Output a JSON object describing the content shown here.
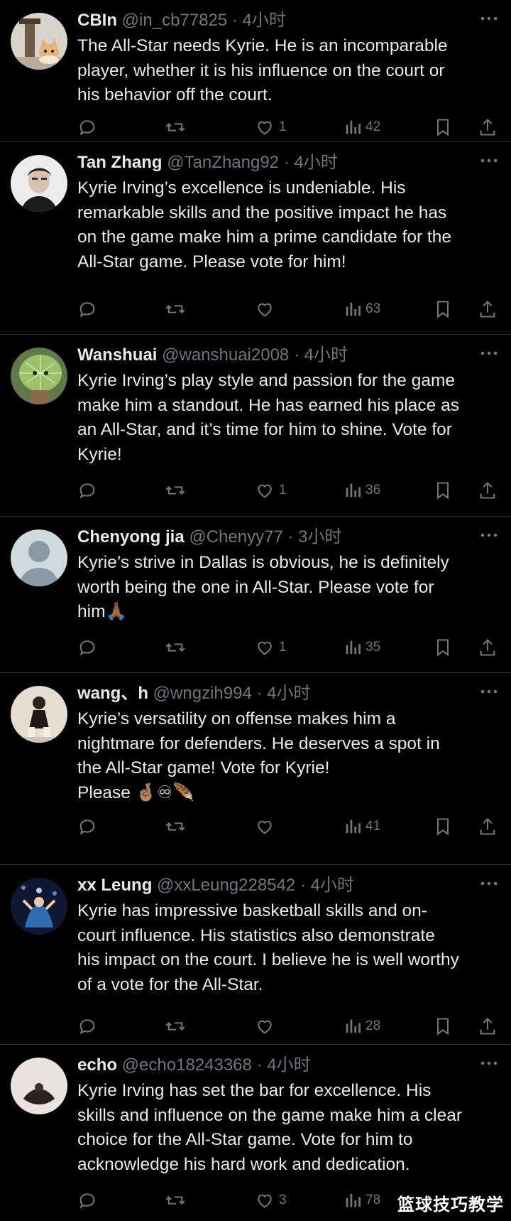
{
  "tweets": [
    {
      "name": "CBIn",
      "handle": "@in_cb77825",
      "time": "4小时",
      "lines": [
        "The All-Star needs Kyrie. He is an incomparable",
        "player, whether it is his influence on the court or",
        "his behavior off the court."
      ],
      "likes": "1",
      "views": "42"
    },
    {
      "name": "Tan Zhang",
      "handle": "@TanZhang92",
      "time": "4小时",
      "lines": [
        "Kyrie Irving’s excellence is undeniable. His",
        "remarkable skills and the positive impact he has",
        "on the game make him a prime candidate for the",
        "All-Star game. Please vote for him!"
      ],
      "likes": "",
      "views": "63"
    },
    {
      "name": "Wanshuai",
      "handle": "@wanshuai2008",
      "time": "4小时",
      "lines": [
        "Kyrie Irving’s play style and passion for the game",
        "make him a standout. He has earned his place as",
        "an All-Star, and it’s time for him to shine. Vote for",
        "Kyrie!"
      ],
      "likes": "1",
      "views": "36"
    },
    {
      "name": "Chenyong jia",
      "handle": "@Chenyy77",
      "time": "3小时",
      "lines": [
        "Kyrie’s strive in Dallas is obvious, he is definitely",
        "worth being the one in All-Star. Please vote for",
        "him🙏🏾"
      ],
      "likes": "1",
      "views": "35"
    },
    {
      "name": "wang、h",
      "handle": "@wngzih994",
      "time": "4小时",
      "lines": [
        "Kyrie’s versatility on offense makes him a",
        "nightmare for defenders. He deserves a spot in",
        "the All-Star game! Vote for Kyrie!",
        "Please 🤞🏽♾🪶"
      ],
      "likes": "",
      "views": "41"
    },
    {
      "name": "xx Leung",
      "handle": "@xxLeung228542",
      "time": "4小时",
      "lines": [
        "Kyrie has impressive basketball skills and on-",
        "court influence. His statistics also demonstrate",
        "his impact on the court. I believe he is well worthy",
        "of a vote for the All-Star."
      ],
      "likes": "",
      "views": "28"
    },
    {
      "name": "echo",
      "handle": "@echo18243368",
      "time": "4小时",
      "lines": [
        "Kyrie Irving has set the bar for excellence. His",
        "skills and influence on the game make him a clear",
        "choice for the All-Star game. Vote for him to",
        "acknowledge his hard work and dedication."
      ],
      "likes": "3",
      "views": "78"
    }
  ],
  "separator": "·",
  "watermark": "篮球技巧教学",
  "icons": [
    "reply-icon",
    "retweet-icon",
    "like-icon",
    "views-icon",
    "bookmark-icon",
    "share-icon",
    "more-icon"
  ],
  "colors": {
    "background": "#000000",
    "text": "#e7e9ea",
    "muted": "#71767b",
    "divider": "#2f3336"
  }
}
